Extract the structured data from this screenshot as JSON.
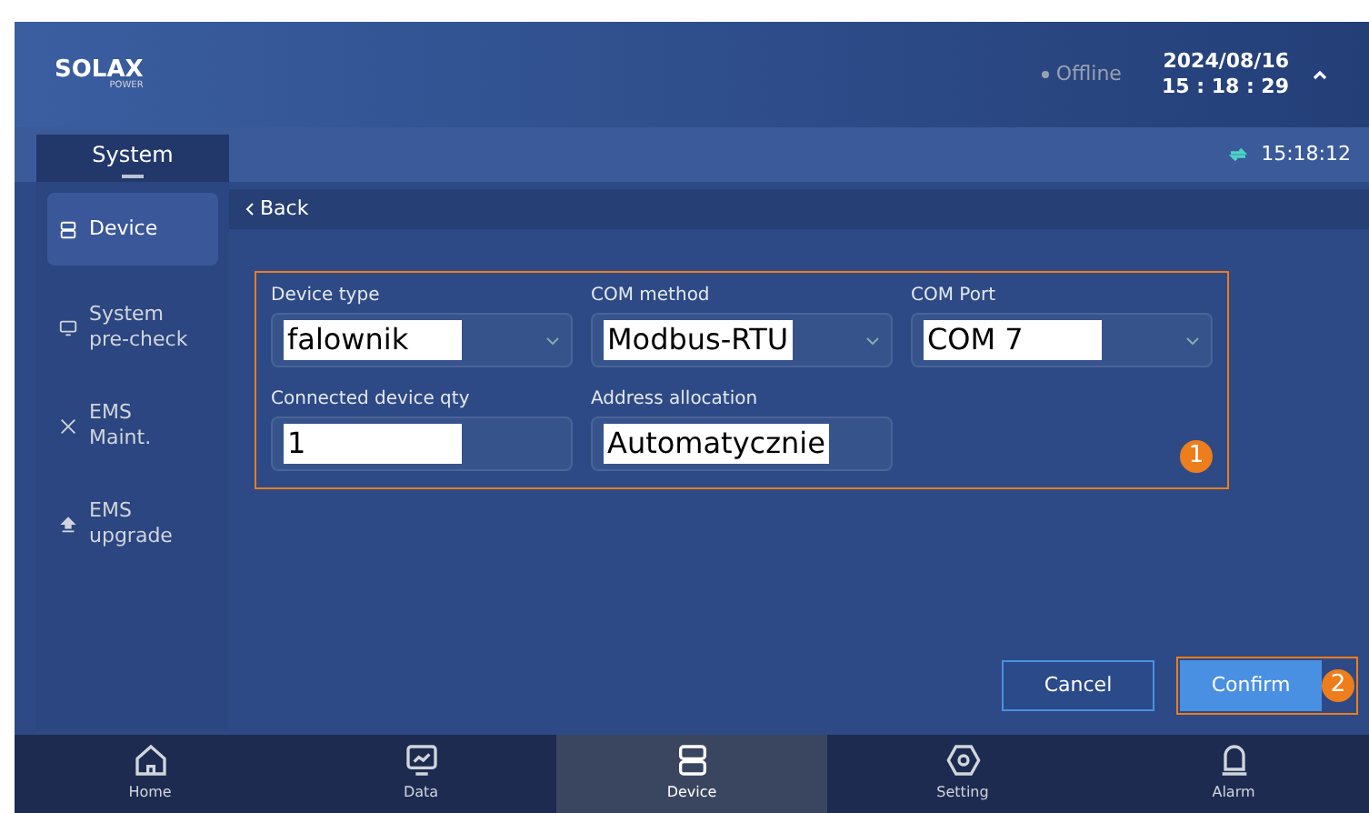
{
  "header": {
    "logo": "SOLAX",
    "logo_sub": "POWER",
    "status": "Offline",
    "date": "2024/08/16",
    "time": "15 : 18 : 29"
  },
  "section_tab": {
    "label": "System",
    "selected": true
  },
  "sync_time": "15:18:12",
  "sidebar": {
    "items": [
      {
        "label": "Device",
        "kind": "device",
        "selected": true
      },
      {
        "label": "System pre-check",
        "kind": "monitor",
        "selected": false
      },
      {
        "label": "EMS Maint.",
        "kind": "tools",
        "selected": false
      },
      {
        "label": "EMS upgrade",
        "kind": "upload",
        "selected": false
      }
    ]
  },
  "back": "Back",
  "form": {
    "fields": [
      {
        "label": "Device type",
        "value": "falownik",
        "kind": "select"
      },
      {
        "label": "COM method",
        "value": "Modbus-RTU",
        "kind": "select"
      },
      {
        "label": "COM Port",
        "value": "COM 7",
        "kind": "select"
      },
      {
        "label": "Connected device qty",
        "value": "1",
        "kind": "input"
      },
      {
        "label": "Address allocation",
        "value": "Automatycznie",
        "kind": "input"
      }
    ],
    "callout": "1"
  },
  "buttons": [
    {
      "label": "Cancel",
      "kind": "secondary"
    },
    {
      "label": "Confirm",
      "kind": "primary",
      "callout": "2"
    }
  ],
  "nav": [
    {
      "label": "Home",
      "kind": "home",
      "selected": false
    },
    {
      "label": "Data",
      "kind": "chart",
      "selected": false
    },
    {
      "label": "Device",
      "kind": "device",
      "selected": true
    },
    {
      "label": "Setting",
      "kind": "gear",
      "selected": false
    },
    {
      "label": "Alarm",
      "kind": "alarm",
      "selected": false
    }
  ]
}
